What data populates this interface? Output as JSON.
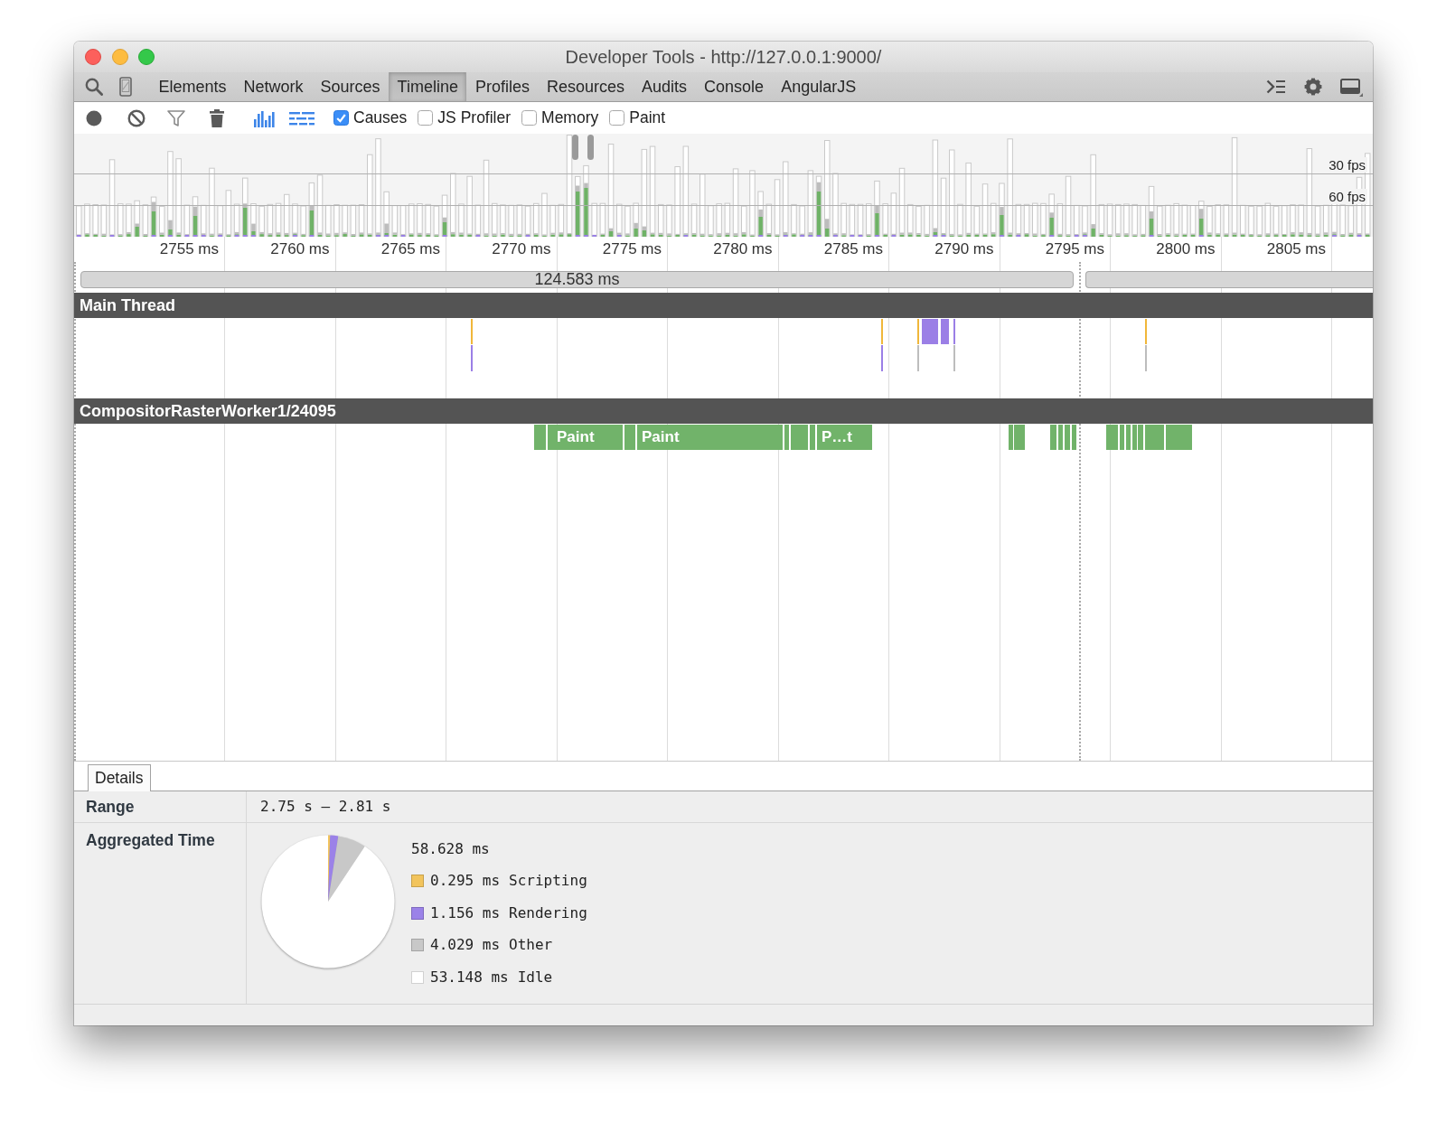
{
  "window": {
    "title": "Developer Tools - http://127.0.0.1:9000/"
  },
  "tabs": [
    {
      "label": "Elements",
      "selected": false
    },
    {
      "label": "Network",
      "selected": false
    },
    {
      "label": "Sources",
      "selected": false
    },
    {
      "label": "Timeline",
      "selected": true
    },
    {
      "label": "Profiles",
      "selected": false
    },
    {
      "label": "Resources",
      "selected": false
    },
    {
      "label": "Audits",
      "selected": false
    },
    {
      "label": "Console",
      "selected": false
    },
    {
      "label": "AngularJS",
      "selected": false
    }
  ],
  "toolbar": {
    "checkboxes": [
      {
        "label": "Causes",
        "checked": true
      },
      {
        "label": "JS Profiler",
        "checked": false
      },
      {
        "label": "Memory",
        "checked": false
      },
      {
        "label": "Paint",
        "checked": false
      }
    ]
  },
  "overview": {
    "fps_labels": [
      "30 fps",
      "60 fps"
    ]
  },
  "ruler": {
    "labels": [
      "2755 ms",
      "2760 ms",
      "2765 ms",
      "2770 ms",
      "2775 ms",
      "2780 ms",
      "2785 ms",
      "2790 ms",
      "2795 ms",
      "2800 ms",
      "2805 ms"
    ]
  },
  "frames": [
    {
      "kind": "labeled",
      "label": "124.583 ms"
    },
    {
      "kind": "cut"
    }
  ],
  "threads": [
    {
      "title": "Main Thread"
    },
    {
      "title": "CompositorRasterWorker1/24095",
      "event_labels": [
        "Paint",
        "Paint",
        "P…t"
      ]
    }
  ],
  "details": {
    "tab": {
      "label": "Details",
      "selected": true
    },
    "range": {
      "label": "Range",
      "value": "2.75 s – 2.81 s"
    },
    "aggregated_time": {
      "label": "Aggregated Time",
      "total": "58.628 ms",
      "chart_data": {
        "type": "pie",
        "categories": [
          "Scripting",
          "Rendering",
          "Other",
          "Idle"
        ],
        "values": [
          0.5,
          1.97,
          6.87,
          90.66
        ]
      },
      "legend": [
        {
          "value": "0.295 ms",
          "color": "#f2c45c"
        },
        {
          "value": "1.156 ms",
          "color": "#9b82e8"
        },
        {
          "value": "4.029 ms",
          "color": "#c8c8c8"
        },
        {
          "value": "53.148 ms",
          "color": "#ffffff"
        }
      ]
    }
  }
}
